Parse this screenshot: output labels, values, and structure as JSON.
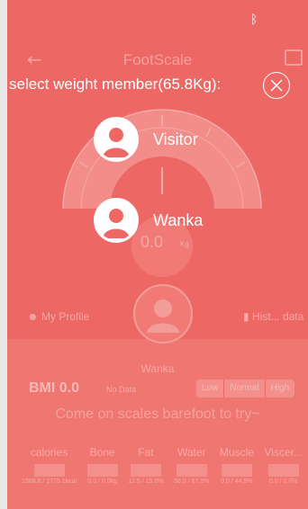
{
  "status_bar": {
    "icon": "bluetooth-icon"
  },
  "app": {
    "title": "FootScale",
    "back_icon": "back-arrow-icon",
    "share_icon": "share-icon"
  },
  "scale": {
    "value": "0.0",
    "unit": "Kg"
  },
  "profile": {
    "my_profile_label": "My Profile",
    "history_label": "Hist... data",
    "name": "Wanka",
    "bmi_label": "BMI 0.0",
    "bmi_status": "No Data",
    "segments": [
      "Low",
      "Normal",
      "High"
    ],
    "hint": "Come on scales barefoot to try~"
  },
  "metrics": [
    {
      "label": "calories",
      "sub": "1508.8 / 1775.1kcal"
    },
    {
      "label": "Bone",
      "sub": "0.0 / 0.0kg"
    },
    {
      "label": "Fat",
      "sub": "12.5 / 15.0%"
    },
    {
      "label": "Water",
      "sub": "58.0 / 67.5%"
    },
    {
      "label": "Muscle",
      "sub": "0.0 / 44.6%"
    },
    {
      "label": "Viscer...",
      "sub": "0.0 / 0.0%"
    }
  ],
  "dialog": {
    "title": "select weight member(65.8Kg):",
    "close_icon": "close-icon",
    "members": [
      {
        "name": "Visitor",
        "icon": "user-avatar-icon"
      },
      {
        "name": "Wanka",
        "icon": "user-avatar-icon"
      }
    ]
  },
  "colors": {
    "overlay": "#ed6865",
    "text": "#ffffff"
  }
}
